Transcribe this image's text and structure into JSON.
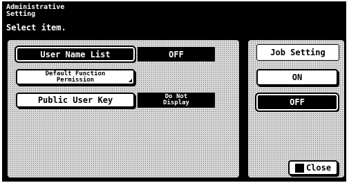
{
  "header": {
    "title": "Administrative\nSetting",
    "subtitle": "Select item."
  },
  "settings": {
    "user_name_list": {
      "label": "User Name List",
      "value": "OFF"
    },
    "default_function_permission": {
      "label": "Default Function\nPermission"
    },
    "public_user_key": {
      "label": "Public User Key",
      "value": "Do Not\nDisplay"
    }
  },
  "job_setting": {
    "label": "Job Setting",
    "on_label": "ON",
    "off_label": "OFF",
    "selected": "OFF"
  },
  "footer": {
    "close_label": "Close"
  }
}
